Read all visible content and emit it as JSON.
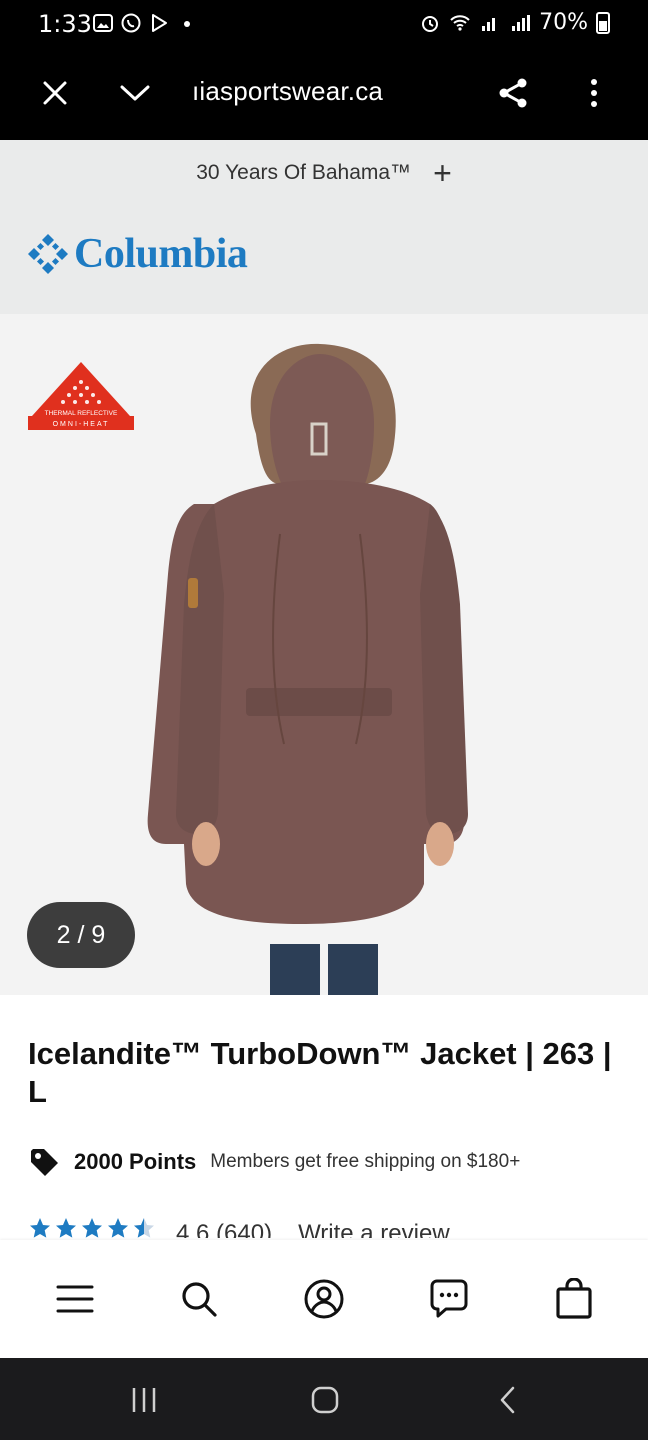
{
  "status_bar": {
    "time": "1:33",
    "battery": "70%"
  },
  "browser": {
    "url": "ıiasportswear.ca"
  },
  "promo": {
    "text": "30 Years Of Bahama™",
    "expand_symbol": "+"
  },
  "brand": {
    "name": "Columbia",
    "color": "#1e7bc2"
  },
  "gallery": {
    "counter": "2 / 9",
    "badge_line1": "THERMAL REFLECTIVE",
    "badge_line2": "OMNI-HEAT",
    "badge_color": "#e0301e",
    "jacket_color": "#7a5652"
  },
  "product": {
    "title": "Icelandite™ TurboDown™ Jacket | 263 | L",
    "points": "2000 Points",
    "shipping_note": "Members get free shipping on $180+",
    "rating": "4.6 (640)",
    "write_review": "Write a review",
    "star_color": "#1e7bc2"
  }
}
